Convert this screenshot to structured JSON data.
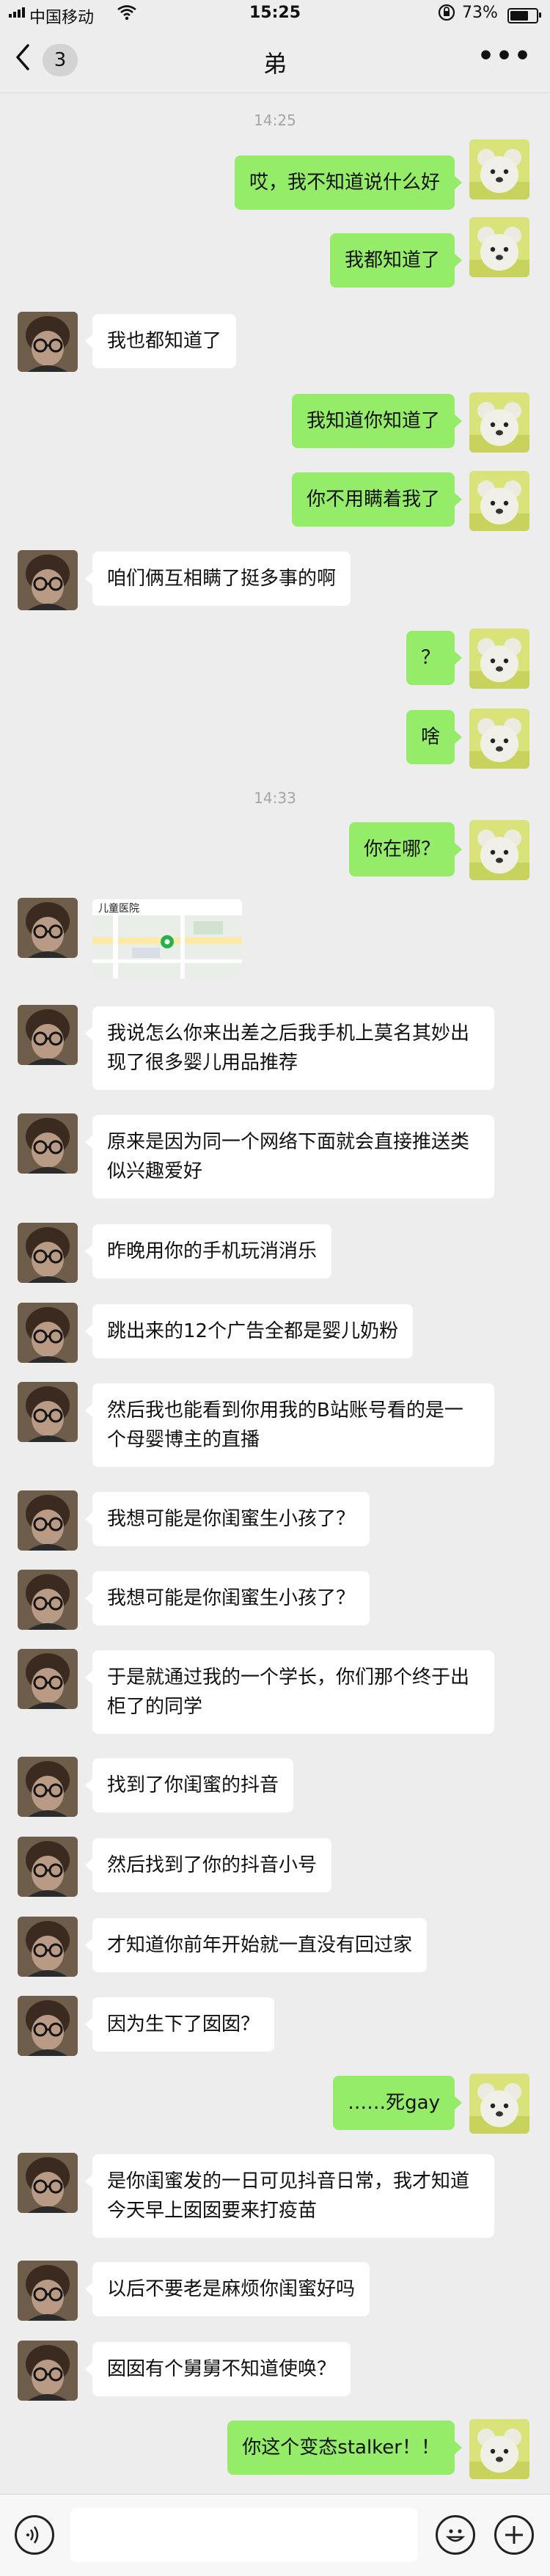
{
  "status_bar": {
    "carrier": "中国移动",
    "time": "15:25",
    "battery": "73%",
    "battery_level": 0.73
  },
  "header": {
    "back_count": "3",
    "title": "弟"
  },
  "timestamps": [
    "14:25",
    "14:33"
  ],
  "messages": [
    {
      "from": "me",
      "text": "哎，我不知道说什么好"
    },
    {
      "from": "me",
      "text": "我都知道了"
    },
    {
      "from": "them",
      "text": "我也都知道了"
    },
    {
      "from": "me",
      "text": "我知道你知道了"
    },
    {
      "from": "me",
      "text": "你不用瞒着我了"
    },
    {
      "from": "them",
      "text": "咱们俩互相瞒了挺多事的啊"
    },
    {
      "from": "me",
      "text": "？"
    },
    {
      "from": "me",
      "text": "啥"
    },
    {
      "from": "me",
      "text": "你在哪？"
    },
    {
      "from": "them",
      "type": "location",
      "text": "儿童医院"
    },
    {
      "from": "them",
      "text": "我说怎么你来出差之后我手机上莫名其妙出现了很多婴儿用品推荐"
    },
    {
      "from": "them",
      "text": "原来是因为同一个网络下面就会直接推送类似兴趣爱好"
    },
    {
      "from": "them",
      "text": "昨晚用你的手机玩消消乐"
    },
    {
      "from": "them",
      "text": "跳出来的12个广告全都是婴儿奶粉"
    },
    {
      "from": "them",
      "text": "然后我也能看到你用我的B站账号看的是一个母婴博主的直播"
    },
    {
      "from": "them",
      "text": "我想可能是你闺蜜生小孩了？"
    },
    {
      "from": "them",
      "text": "我想可能是你闺蜜生小孩了？"
    },
    {
      "from": "them",
      "text": "于是就通过我的一个学长，你们那个终于出柜了的同学"
    },
    {
      "from": "them",
      "text": "找到了你闺蜜的抖音"
    },
    {
      "from": "them",
      "text": "然后找到了你的抖音小号"
    },
    {
      "from": "them",
      "text": "才知道你前年开始就一直没有回过家"
    },
    {
      "from": "them",
      "text": "因为生下了囡囡？"
    },
    {
      "from": "me",
      "text": "……死gay"
    },
    {
      "from": "them",
      "text": "是你闺蜜发的一日可见抖音日常，我才知道今天早上囡囡要来打疫苗"
    },
    {
      "from": "them",
      "text": "以后不要老是麻烦你闺蜜好吗"
    },
    {
      "from": "them",
      "text": "囡囡有个舅舅不知道使唤？"
    },
    {
      "from": "me",
      "text": "你这个变态stalker！！"
    }
  ],
  "input_bar": {
    "voice_icon": "voice-icon",
    "emoji_icon": "emoji-icon",
    "plus_icon": "plus-icon"
  },
  "colors": {
    "background": "#ededed",
    "outgoing_bubble": "#95ec69",
    "incoming_bubble": "#ffffff"
  }
}
